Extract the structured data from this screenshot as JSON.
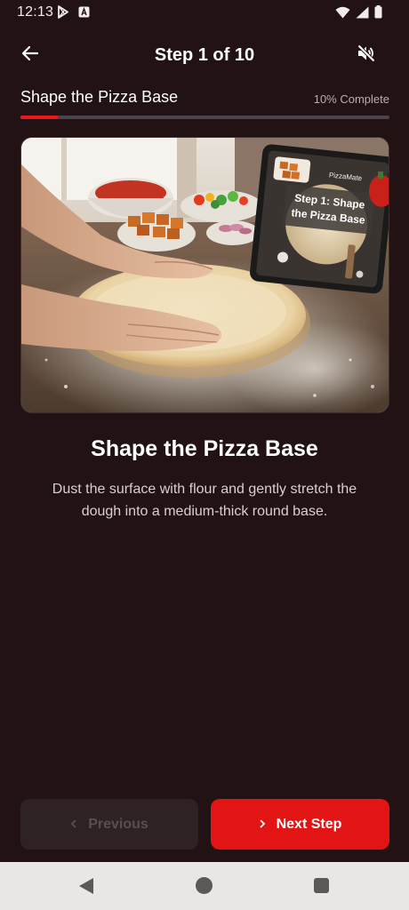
{
  "status_bar": {
    "time": "12:13",
    "icons": [
      "play-store-icon",
      "notification-a-icon",
      "wifi-icon",
      "signal-icon",
      "battery-icon"
    ]
  },
  "app_bar": {
    "title": "Step 1 of 10",
    "back_icon": "arrow-left-icon",
    "mute_icon": "volume-off-icon"
  },
  "progress": {
    "label": "Shape the Pizza Base",
    "percent_text": "10% Complete",
    "value": 0.1,
    "fill_color": "#e8181a",
    "track_color": "#4a4450"
  },
  "hero_image": {
    "tablet_brand": "PizzaMate",
    "tablet_caption_line1": "Step 1: Shape",
    "tablet_caption_line2": "the Pizza Base"
  },
  "step": {
    "title": "Shape the Pizza Base",
    "description": "Dust the surface with flour and gently stretch the dough into a medium-thick round base."
  },
  "buttons": {
    "previous_label": "Previous",
    "next_label": "Next Step",
    "previous_enabled": false,
    "next_color": "#e31514"
  },
  "colors": {
    "background": "#221213",
    "accent": "#e31514"
  }
}
